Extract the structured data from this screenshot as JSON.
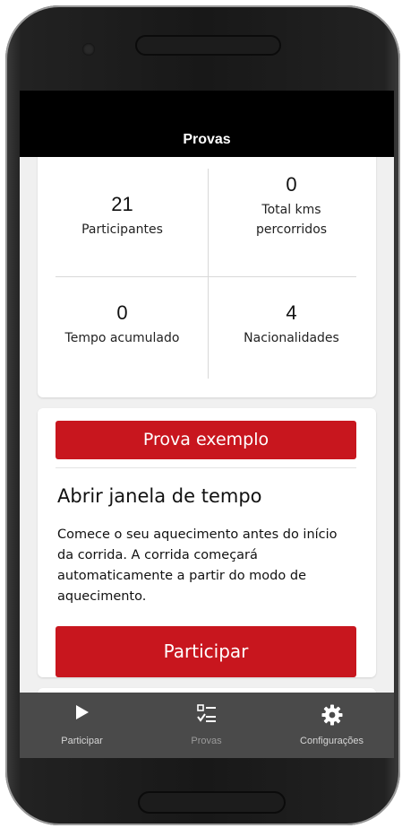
{
  "header": {
    "title": "Provas"
  },
  "stats": [
    {
      "value": "21",
      "label": "Participantes"
    },
    {
      "value": "0",
      "label": "Total kms percorridos"
    },
    {
      "value": "0",
      "label": "Tempo acumulado"
    },
    {
      "value": "4",
      "label": "Nacionalidades"
    }
  ],
  "race": {
    "name": "Prova exemplo",
    "title": "Abrir janela de tempo",
    "description": "Comece o seu aquecimento antes do início da corrida. A corrida começará automaticamente a partir do modo de aquecimento.",
    "join_label": "Participar"
  },
  "tabs": [
    {
      "label": "Participar",
      "icon": "play-icon"
    },
    {
      "label": "Provas",
      "icon": "checklist-icon"
    },
    {
      "label": "Configurações",
      "icon": "gear-icon"
    }
  ],
  "colors": {
    "accent": "#c8161e",
    "header": "#000000",
    "tabbar": "#4a4a4a"
  }
}
